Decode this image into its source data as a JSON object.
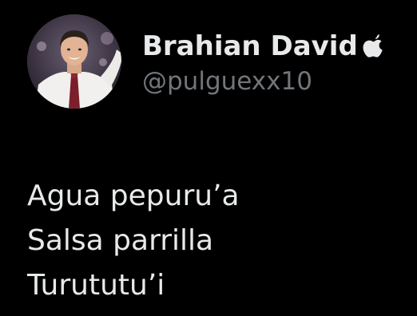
{
  "tweet": {
    "author": {
      "display_name": "Brahian David",
      "badge_icon": "apple-icon",
      "handle": "@pulguexx10",
      "avatar_icon": "profile-photo"
    },
    "lines": [
      "Agua pepuru’a",
      "Salsa parrilla",
      "Turututu’i"
    ]
  },
  "colors": {
    "background": "#000000",
    "primary_text": "#e7e9ea",
    "secondary_text": "#71767b"
  }
}
